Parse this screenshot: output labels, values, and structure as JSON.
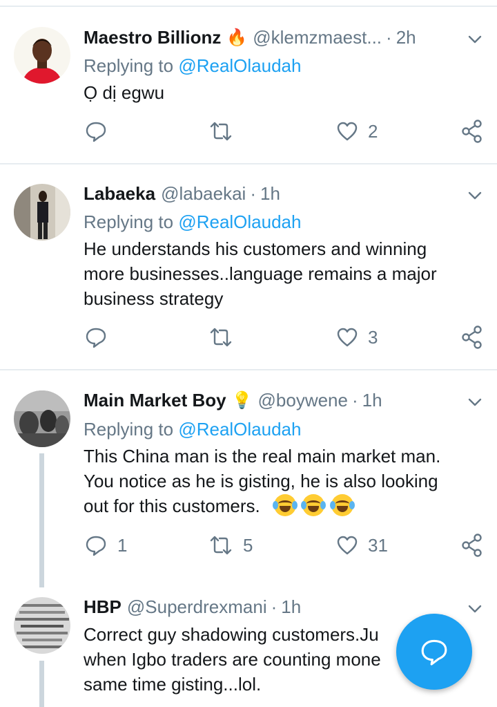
{
  "tweets": [
    {
      "name": "Maestro Billionz",
      "name_emoji": "🔥",
      "handle": "@klemzmaest...",
      "separator": "·",
      "time": "2h",
      "reply_prefix": "Replying to",
      "reply_to": "@RealOlaudah",
      "text": "Ọ dị egwu",
      "reply_count": "",
      "retweet_count": "",
      "like_count": "2"
    },
    {
      "name": "Labaeka",
      "handle": "@labaekai",
      "separator": "·",
      "time": "1h",
      "reply_prefix": "Replying to",
      "reply_to": "@RealOlaudah",
      "text_lines": [
        "He understands his customers and winning",
        "more businesses..language remains a major",
        "business strategy"
      ],
      "reply_count": "",
      "retweet_count": "",
      "like_count": "3"
    },
    {
      "name": "Main Market Boy",
      "name_emoji": "💡",
      "handle": "@boywene",
      "separator": "·",
      "time": "1h",
      "reply_prefix": "Replying to",
      "reply_to": "@RealOlaudah",
      "text_lines": [
        "This China man is the real main market man.",
        "You notice as he is gisting, he is also looking",
        "out for this customers."
      ],
      "text_emojis": [
        "😂",
        "😂",
        "😂"
      ],
      "reply_count": "1",
      "retweet_count": "5",
      "like_count": "31"
    },
    {
      "name": "HBP",
      "handle": "@Superdrexmani",
      "separator": "·",
      "time": "1h",
      "text_lines": [
        "Correct guy shadowing customers.Ju",
        "when Igbo traders are counting mone",
        "same time gisting...lol."
      ]
    }
  ],
  "icons": {
    "reply": "reply-icon",
    "retweet": "retweet-icon",
    "like": "heart-icon",
    "share": "share-icon",
    "more": "chevron-down-icon",
    "compose": "compose-reply-icon"
  },
  "colors": {
    "accent": "#1da1f2",
    "muted": "#657786",
    "text": "#14171a",
    "divider": "#e6ecf0"
  }
}
